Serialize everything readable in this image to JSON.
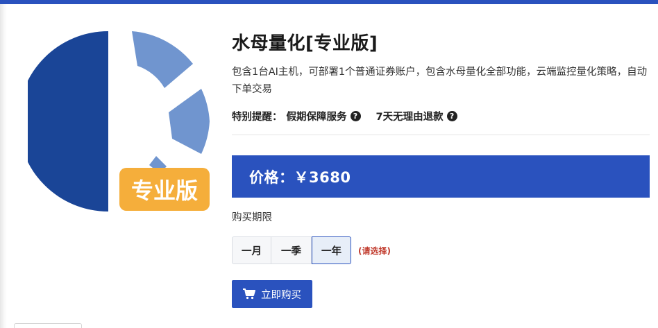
{
  "product": {
    "title": "水母量化[专业版]",
    "description": "包含1台AI主机，可部署1个普通证券账户，包含水母量化全部功能，云端监控量化策略，自动下单交易",
    "logo_badge": "专业版",
    "notice_label": "特别提醒：",
    "notices": [
      {
        "text": "假期保障服务",
        "icon": "question-circle-icon"
      },
      {
        "text": "7天无理由退款",
        "icon": "question-circle-icon"
      }
    ]
  },
  "price": {
    "label": "价格：￥3680"
  },
  "purchase": {
    "period_label": "购买期限",
    "options": [
      "一月",
      "一季",
      "一年"
    ],
    "selected": "一年",
    "hint": "(请选择)",
    "buy_label": "立即购买",
    "buy_icon": "cart-icon"
  },
  "colors": {
    "accent": "#2a52be",
    "logo_dark": "#1a4597",
    "logo_light": "#7095cf",
    "badge": "#f5ae3b",
    "hint": "#c0392b"
  }
}
